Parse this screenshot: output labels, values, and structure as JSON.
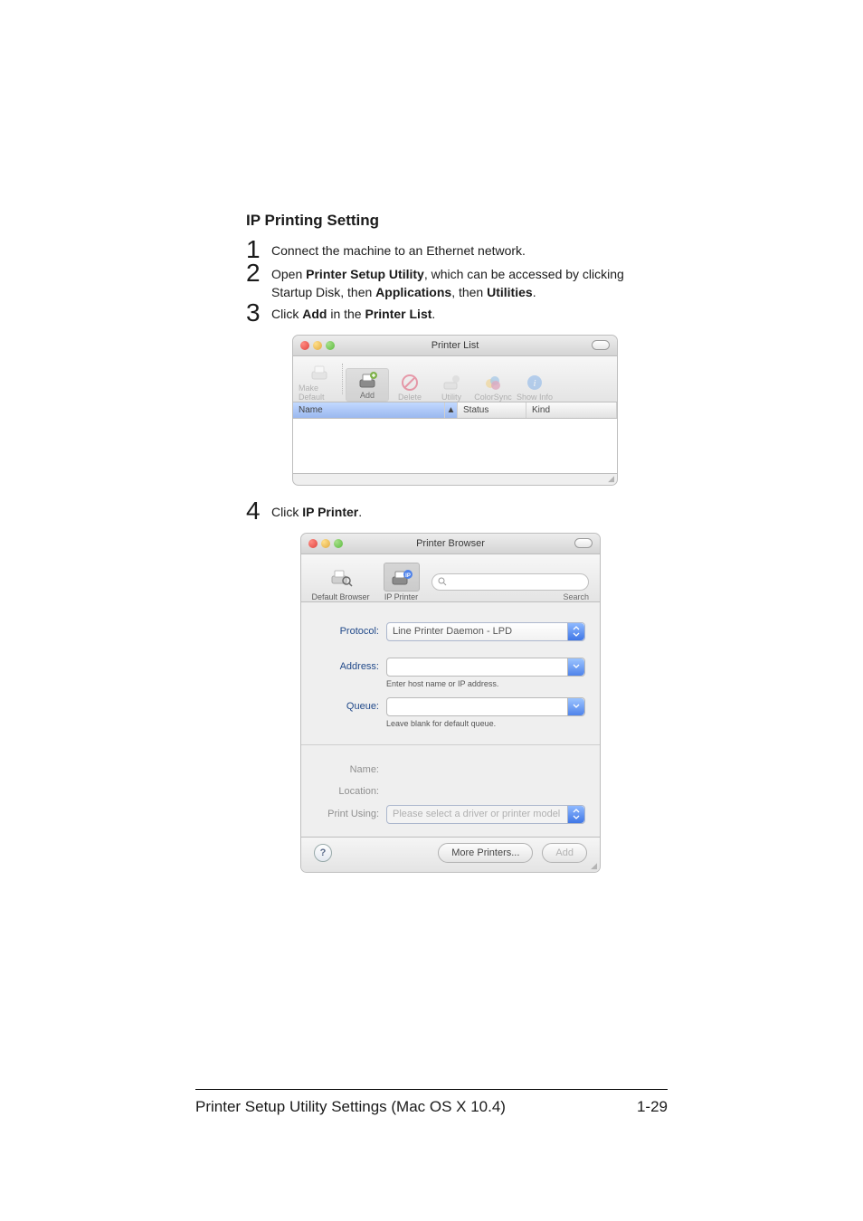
{
  "heading": "IP Printing Setting",
  "steps": {
    "s1": "Connect the machine to an Ethernet network.",
    "s2a": "Open ",
    "s2b": "Printer Setup Utility",
    "s2c": ", which can be accessed by clicking Startup Disk, then ",
    "s2d": "Applications",
    "s2e": ", then ",
    "s2f": "Utilities",
    "s2g": ".",
    "s3a": "Click ",
    "s3b": "Add",
    "s3c": " in the ",
    "s3d": "Printer List",
    "s3e": ".",
    "s4a": "Click ",
    "s4b": "IP Printer",
    "s4c": "."
  },
  "step_nums": {
    "n1": "1",
    "n2": "2",
    "n3": "3",
    "n4": "4"
  },
  "printer_list": {
    "title": "Printer List",
    "toolbar": {
      "make_default": "Make Default",
      "add": "Add",
      "delete": "Delete",
      "utility": "Utility",
      "colorsync": "ColorSync",
      "show_info": "Show Info"
    },
    "columns": {
      "name": "Name",
      "status": "Status",
      "kind": "Kind"
    },
    "sort_glyph": "▲",
    "rows": []
  },
  "printer_browser": {
    "title": "Printer Browser",
    "tabs": {
      "default_browser": "Default Browser",
      "ip_printer": "IP Printer",
      "search": "Search"
    },
    "search_placeholder": "",
    "search_glyph": "Q-",
    "form": {
      "protocol_label": "Protocol:",
      "protocol_value": "Line Printer Daemon - LPD",
      "address_label": "Address:",
      "address_value": "",
      "address_hint": "Enter host name or IP address.",
      "queue_label": "Queue:",
      "queue_value": "",
      "queue_hint": "Leave blank for default queue.",
      "name_label": "Name:",
      "name_value": "",
      "location_label": "Location:",
      "location_value": "",
      "print_using_label": "Print Using:",
      "print_using_value": "Please select a driver or printer model"
    },
    "buttons": {
      "help": "?",
      "more_printers": "More Printers...",
      "add": "Add"
    }
  },
  "footer": {
    "left": "Printer Setup Utility Settings (Mac OS X 10.4)",
    "right": "1-29"
  },
  "icons": {
    "printer": "printer-icon",
    "printer_add": "printer-add-icon",
    "no": "delete-icon",
    "utility": "utility-icon",
    "colorsync": "colorsync-icon",
    "info": "info-icon",
    "loupe": "search-loupe-icon",
    "ip": "ip-printer-icon",
    "chevrons": "select-chevrons-icon",
    "caret": "caret-down-icon"
  }
}
